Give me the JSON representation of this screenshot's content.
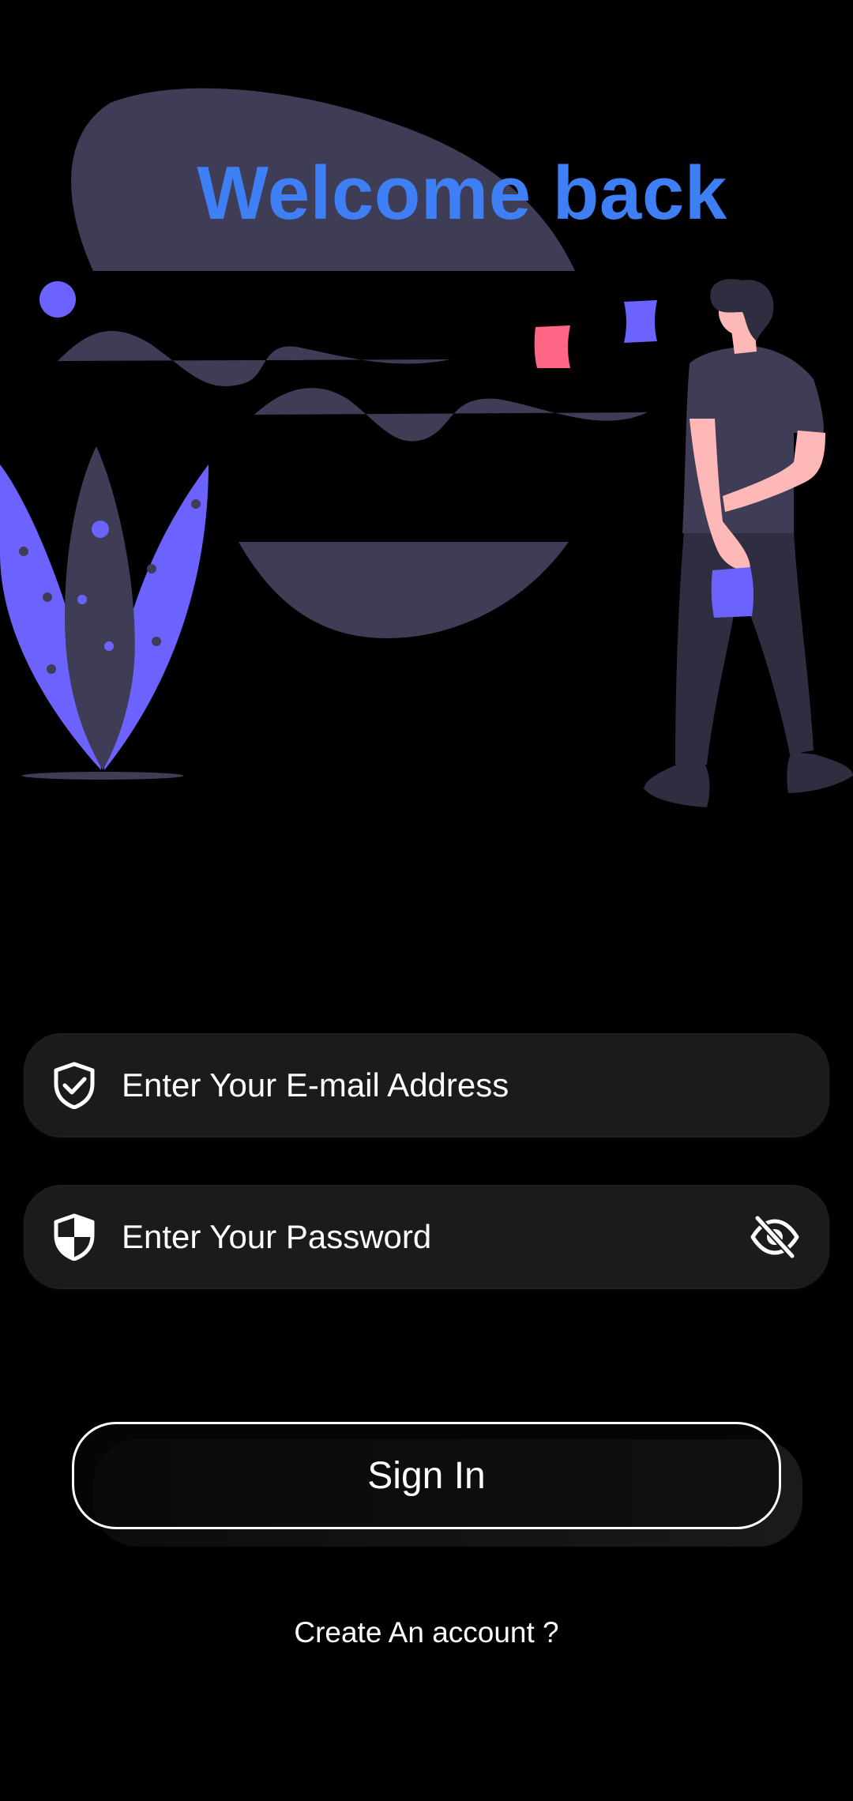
{
  "header": {
    "title": "Welcome back",
    "title_color": "#3e7ff6"
  },
  "form": {
    "email": {
      "placeholder": "Enter Your E-mail Address",
      "value": "",
      "icon": "shield-check-icon"
    },
    "password": {
      "placeholder": "Enter Your Password",
      "value": "",
      "icon": "shield-half-icon",
      "toggle_icon": "eye-off-icon"
    },
    "submit_label": "Sign In",
    "create_account_label": "Create An account ?"
  },
  "colors": {
    "background": "#000000",
    "field_background": "#1b1b1b",
    "illustration_purple": "#6c63ff",
    "illustration_gray": "#3f3d56",
    "illustration_pink": "#ff6584",
    "skin": "#ffb8b8"
  }
}
